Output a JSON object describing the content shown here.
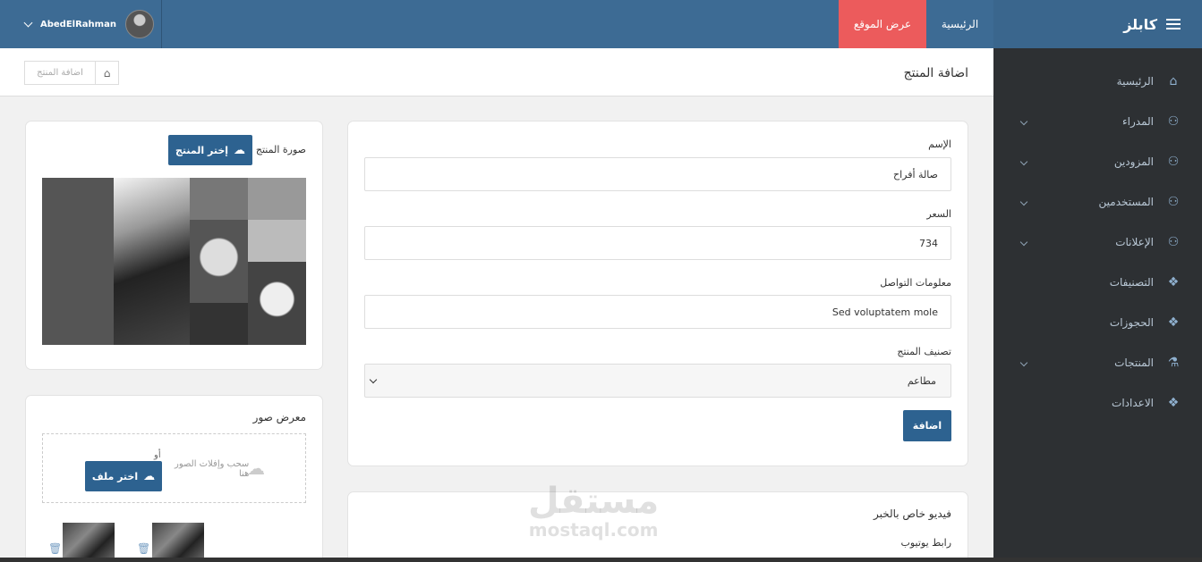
{
  "brand": {
    "title": "كابلز"
  },
  "topnav": {
    "home": "الرئيسية",
    "view_site": "عرض الموقع"
  },
  "user": {
    "name": "AbedElRahman"
  },
  "sidebar": {
    "items": [
      {
        "label": "الرئيسية",
        "icon": "home-icon",
        "has_children": false
      },
      {
        "label": "المدراء",
        "icon": "user-icon",
        "has_children": true
      },
      {
        "label": "المزودين",
        "icon": "user-icon",
        "has_children": true
      },
      {
        "label": "المستخدمين",
        "icon": "user-icon",
        "has_children": true
      },
      {
        "label": "الإعلانات",
        "icon": "user-icon",
        "has_children": true
      },
      {
        "label": "التصنيفات",
        "icon": "cubes-icon",
        "has_children": false
      },
      {
        "label": "الحجوزات",
        "icon": "cubes-icon",
        "has_children": false
      },
      {
        "label": "المنتجات",
        "icon": "flask-icon",
        "has_children": true
      },
      {
        "label": "الاعدادات",
        "icon": "cubes-icon",
        "has_children": false
      }
    ]
  },
  "page": {
    "title": "اضافة المنتج",
    "breadcrumb": "اضافة المنتج"
  },
  "form": {
    "name_label": "الإسم",
    "name_value": "صالة أفراح",
    "price_label": "السعر",
    "price_value": "734",
    "contact_label": "معلومات التواصل",
    "contact_value": "Sed voluptatem mole",
    "category_label": "تصنيف المنتج",
    "category_value": "مطاعم",
    "submit": "اضافة"
  },
  "image_card": {
    "label": "صورة المنتج",
    "choose": "إختر المنتج"
  },
  "gallery": {
    "title": "معرض صور",
    "drop_line1": "سحب وإفلات الصور",
    "drop_line2": "هنا",
    "or": "أو",
    "choose_file": "اختر ملف"
  },
  "video_card": {
    "title": "فيديو خاص بالخبر",
    "youtube_label": "رابط يوتيوب"
  },
  "watermark": {
    "line1": "مستقل",
    "line2": "mostaql.com"
  }
}
